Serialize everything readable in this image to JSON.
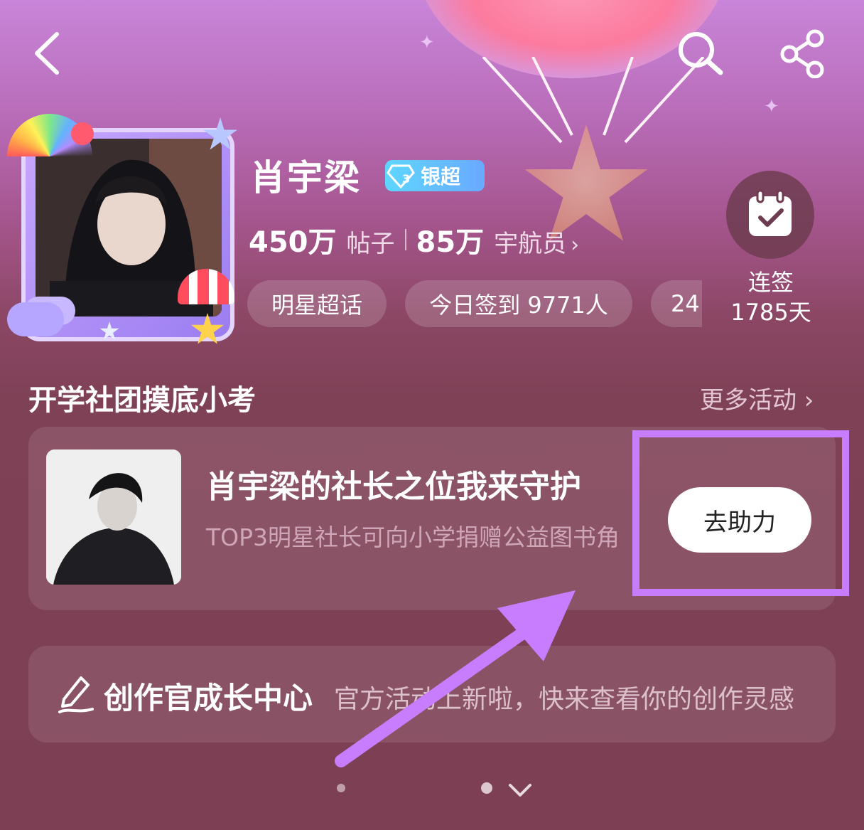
{
  "header": {
    "name": "肖宇梁",
    "badge_level": "3",
    "badge_label": "银超",
    "posts_count": "450万",
    "posts_label": "帖子",
    "members_count": "85万",
    "members_label": "宇航员",
    "members_chevron": "›",
    "chips": [
      "明星超话",
      "今日签到 9771人",
      "24"
    ],
    "checkin_line1": "连签",
    "checkin_line2": "1785天"
  },
  "icons": {
    "back": "back-icon",
    "search": "search-icon",
    "share": "share-icon",
    "calendar_check": "calendar-check-icon",
    "pen": "pen-icon",
    "chevron_down": "chevron-down-icon"
  },
  "section": {
    "title": "开学社团摸底小考",
    "more": "更多活动 ›"
  },
  "activity": {
    "title": "肖宇梁的社长之位我来守护",
    "desc": "TOP3明星社长可向小学捐赠公益图书角",
    "button": "去助力"
  },
  "creator": {
    "title": "创作官成长中心",
    "subtitle": "官方活动上新啦，快来查看你的创作灵感"
  },
  "colors": {
    "annotation_purple": "#c87dff",
    "badge_blue": "#5ed6ff",
    "page_bg": "#7c3f53"
  }
}
